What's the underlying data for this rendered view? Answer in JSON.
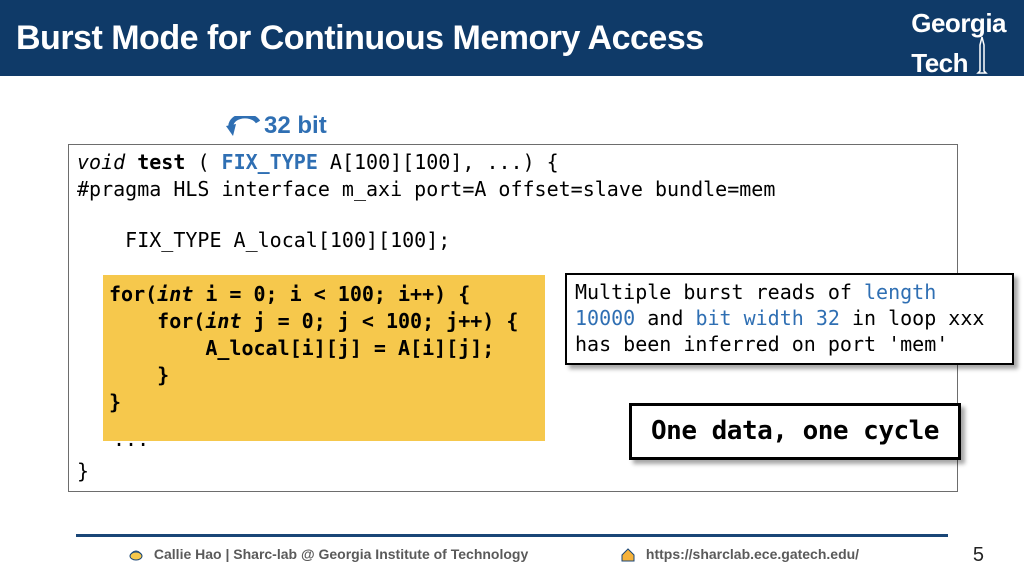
{
  "header": {
    "title": "Burst Mode for Continuous Memory Access",
    "logo_line1": "Georgia",
    "logo_line2": "Tech"
  },
  "annotation": {
    "label": "32 bit"
  },
  "code": {
    "sig_void": "void",
    "sig_fn": "test",
    "sig_open": "( ",
    "sig_type": "FIX_TYPE",
    "sig_rest": " A[100][100], ...) {",
    "pragma": "#pragma HLS interface m_axi port=A offset=slave bundle=mem",
    "decl": "    FIX_TYPE A_local[100][100];",
    "hl_l1a": "for(",
    "hl_l1b": "int",
    "hl_l1c": " i = 0; i < 100; i++) {",
    "hl_l2a": "    for(",
    "hl_l2b": "int",
    "hl_l2c": " j = 0; j < 100; j++) {",
    "hl_l3": "        A_local[i][j] = A[i][j];",
    "hl_l4": "    }",
    "hl_l5": "}",
    "tail": "...",
    "closing": "}"
  },
  "note": {
    "p1": "Multiple burst reads of ",
    "length_kw": "length",
    "p2": " ",
    "length_val": "10000",
    "p3": " and ",
    "bw_kw": "bit width 32",
    "p4": " in loop xxx has been inferred on port 'mem'"
  },
  "callout": {
    "text": "One data, one cycle"
  },
  "footer": {
    "author": "Callie Hao | Sharc-lab @ Georgia Institute of Technology",
    "url": "https://sharclab.ece.gatech.edu/",
    "page": "5"
  }
}
